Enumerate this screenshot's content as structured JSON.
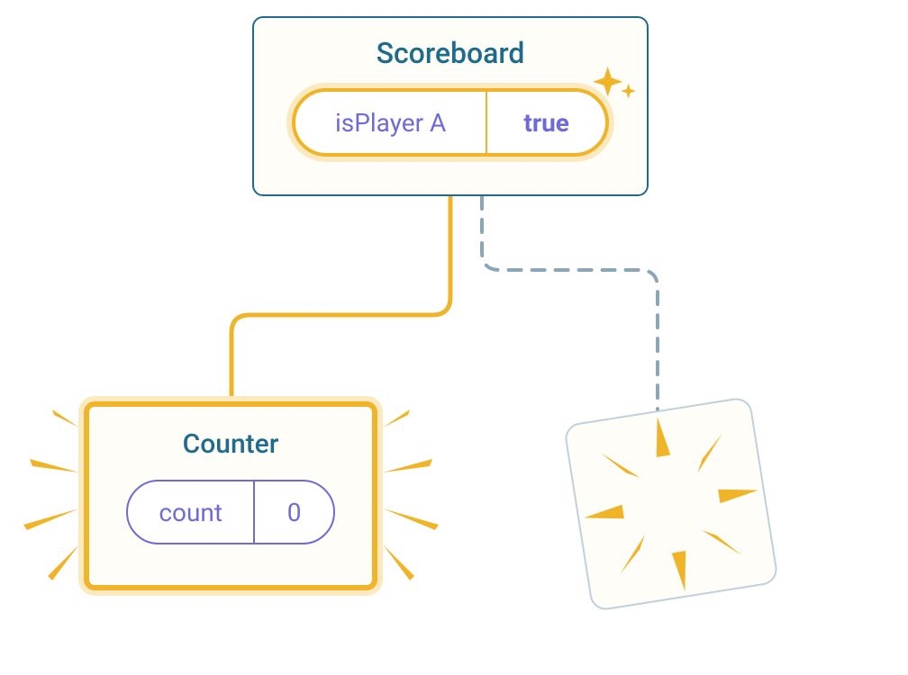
{
  "diagram": {
    "scoreboard": {
      "title": "Scoreboard",
      "state": {
        "name": "isPlayer A",
        "value": "true"
      }
    },
    "counter": {
      "title": "Counter",
      "state": {
        "name": "count",
        "value": "0"
      }
    }
  }
}
